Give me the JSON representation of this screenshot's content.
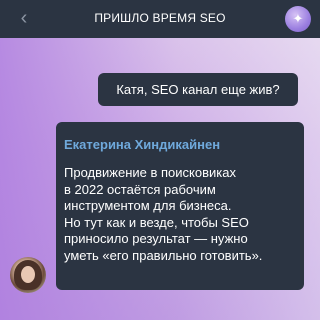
{
  "header": {
    "back_icon": "chevron-left-icon",
    "title": "ПРИШЛО ВРЕМЯ SEO",
    "avatar_icon": "sparkle-icon"
  },
  "messages": [
    {
      "direction": "outgoing",
      "text": "Катя, SEO канал еще жив?"
    },
    {
      "direction": "incoming",
      "sender": "Екатерина Хиндикайнен",
      "text": "Продвижение в поисковиках\nв 2022 остаётся рабочим\nинструментом для бизнеса.\nНо тут как и везде, чтобы SEO\nприносило результат — нужно\nуметь «его правильно готовить».",
      "avatar_icon": "user-avatar"
    }
  ],
  "colors": {
    "bar": "#2b3442",
    "bubble": "#2b3442",
    "sender_name": "#6fa9dc",
    "text": "#ffffff"
  }
}
